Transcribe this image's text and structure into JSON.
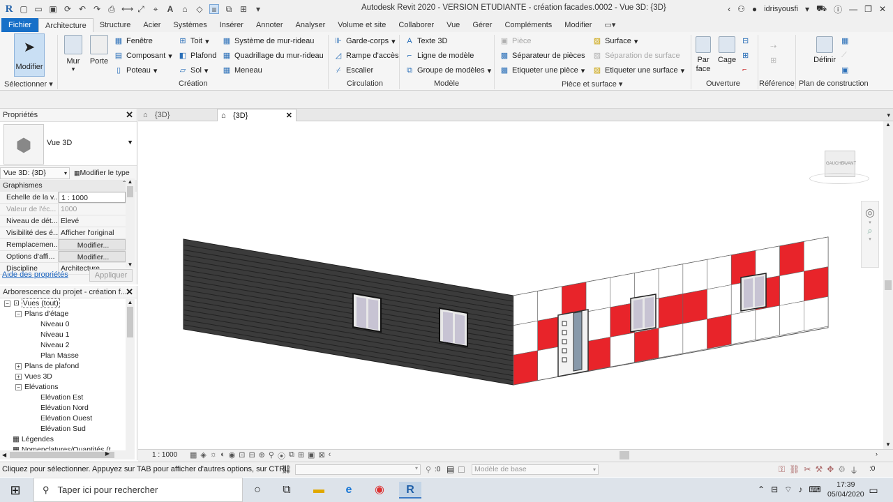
{
  "window": {
    "title": "Autodesk Revit 2020 - VERSION ETUDIANTE - création facades.0002 - Vue 3D: {3D}",
    "user": "idrisyousfi",
    "app_logo": "R"
  },
  "tabs": [
    "Fichier",
    "Architecture",
    "Structure",
    "Acier",
    "Systèmes",
    "Insérer",
    "Annoter",
    "Analyser",
    "Volume et site",
    "Collaborer",
    "Vue",
    "Gérer",
    "Compléments",
    "Modifier"
  ],
  "active_tab": "Architecture",
  "ribbon": {
    "select": {
      "button": "Modifier",
      "panel": "Sélectionner"
    },
    "creation": {
      "panel": "Création",
      "mur": "Mur",
      "porte": "Porte",
      "fenetre": "Fenêtre",
      "composant": "Composant",
      "poteau": "Poteau",
      "toit": "Toit",
      "plafond": "Plafond",
      "sol": "Sol",
      "systeme_mur_rideau": "Système de mur-rideau",
      "quadrillage": "Quadrillage du mur-rideau",
      "meneau": "Meneau"
    },
    "circulation": {
      "panel": "Circulation",
      "garde_corps": "Garde-corps",
      "rampe": "Rampe d'accès",
      "escalier": "Escalier"
    },
    "modele": {
      "panel": "Modèle",
      "texte3d": "Texte 3D",
      "ligne": "Ligne de modèle",
      "groupe": "Groupe de modèles"
    },
    "piece": {
      "panel": "Pièce et surface",
      "piece": "Pièce",
      "separateur": "Séparateur  de pièces",
      "etiqueter_piece": "Etiqueter  une pièce",
      "surface": "Surface",
      "separation_surface": "Séparation  de surface",
      "etiqueter_surface": "Etiqueter  une surface"
    },
    "ouverture": {
      "panel": "Ouverture",
      "par_face": "Par face",
      "cage": "Cage"
    },
    "reference": {
      "panel": "Référence"
    },
    "plan": {
      "panel": "Plan de construction",
      "definir": "Définir"
    }
  },
  "properties": {
    "title": "Propriétés",
    "type_name": "Vue 3D",
    "selector": "Vue 3D: {3D}",
    "edit_type": "Modifier le type",
    "section": "Graphismes",
    "rows": [
      {
        "k": "Echelle de la v...",
        "v": "1 : 1000"
      },
      {
        "k": "Valeur de l'éc...",
        "v": "1000"
      },
      {
        "k": "Niveau de dét...",
        "v": "Elevé"
      },
      {
        "k": "Visibilité des é...",
        "v": "Afficher l'original"
      },
      {
        "k": "Remplacemen...",
        "v": "Modifier..."
      },
      {
        "k": "Options d'affi...",
        "v": "Modifier..."
      },
      {
        "k": "Discipline",
        "v": "Architecture"
      }
    ],
    "help_link": "Aide des propriétés",
    "apply": "Appliquer"
  },
  "browser": {
    "title": "Arborescence du projet - création f...",
    "nodes": [
      "Vues (tout)",
      "Plans d'étage",
      "Niveau 0",
      "Niveau 1",
      "Niveau 2",
      "Plan Masse",
      "Plans de plafond",
      "Vues 3D",
      "Elévations",
      "Elévation Est",
      "Elévation Nord",
      "Elévation Ouest",
      "Elévation Sud",
      "Légendes",
      "Nomenclatures/Quantités (t..."
    ]
  },
  "view_tabs": [
    "{3D}",
    "{3D}"
  ],
  "viewcube": {
    "left": "GAUCHE",
    "front": "AVANT"
  },
  "view_bar": {
    "scale": "1 : 1000"
  },
  "status": {
    "hint": "Cliquez pour sélectionner. Appuyez sur TAB pour afficher d'autres options, sur CTRL",
    "zero": ":0",
    "model": "Modèle de base",
    "filter_count": ":0"
  },
  "taskbar": {
    "search_placeholder": "Taper ici pour rechercher",
    "time": "17:39",
    "date": "05/04/2020"
  },
  "colors": {
    "accent": "#1870c8",
    "red_panel": "#e8242a",
    "siding": "#3c3c3c"
  }
}
